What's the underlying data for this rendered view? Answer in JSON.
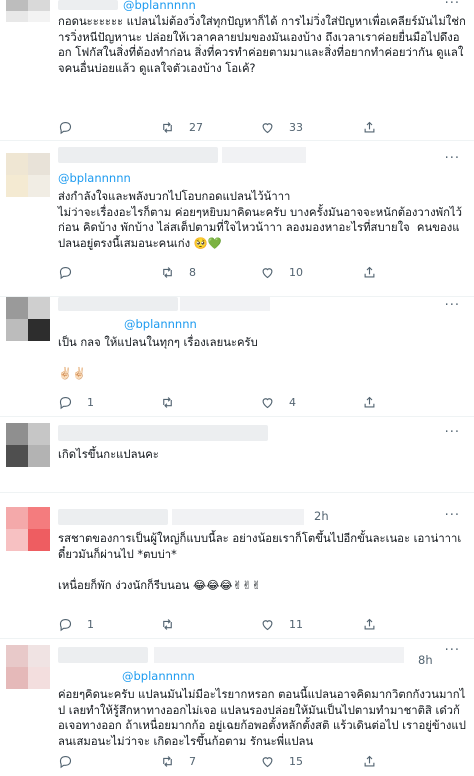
{
  "tweets": [
    {
      "name_hidden": true,
      "handle": "@bplannnnn",
      "reply_to": "",
      "time": "",
      "body": "กอดนะะะะะะ แปลนไม่ต้องวิ่งใส่ทุกปัญหาก็ได้ การไม่วิ่งใส่ปัญหาเพื่อเคลียร์มันไม่ใช่การวิ่งหนีปัญหานะ ปล่อยให้เวลาคลายปมของมันเองบ้าง ถึงเวลาเราค่อยยื่นมือไปดึงออก โฟกัสในสิ่งที่ต้องทำก่อน สิ่งที่ควรทำค่อยตามมาและสิ่งที่อยากทำค่อยว่ากัน ดูแลใจคนอื่นบ่อยแล้ว ดูแลใจตัวเองบ้าง โอเค้?",
      "replies": "",
      "retweets": "27",
      "likes": "33"
    },
    {
      "name_hidden": true,
      "handle": "",
      "reply_to": "@bplannnnn",
      "time": "",
      "body": "ส่งกำลังใจและพลังบวกไปโอบกอดแปลนไว้น้าาา\nไม่ว่าจะเรื่องอะไรก็ตาม ค่อยๆหยิบมาคิดนะครับ บางครั้งมันอาจจะหนักต้องวางพักไว้ก่อน คิดบ้าง พักบ้าง ไล่สเต็ปตามที่ใจไหวน้าาา ลองมองหาอะไรที่สบายใจ  คนของแปลนอยู่ตรงนี้เสมอนะคนเก่ง 🥺💚",
      "replies": "",
      "retweets": "8",
      "likes": "10"
    },
    {
      "name_hidden": true,
      "handle": "@bplannnnn",
      "reply_to": "",
      "time": "",
      "body": "เป็น กลจ ให้แปลนในทุกๆ เรื่องเลยนะครับ\n\n✌🏻✌🏻",
      "replies": "1",
      "retweets": "",
      "likes": "4"
    },
    {
      "name_hidden": true,
      "handle": "",
      "reply_to": "",
      "time": "",
      "body": "เกิดไรขึ้นกะแปลนคะ",
      "replies": "",
      "retweets": "",
      "likes": ""
    },
    {
      "name_hidden": true,
      "handle": "",
      "reply_to": "",
      "time": "2h",
      "body": "รสชาตของการเป็นผู้ใหญ่ก็แบบนี้ละ อย่างน้อยเราก็โตขึ้นไปอีกขั้นละเนอะ เอาน่าาาเดี๋ยวมันก็ผ่านไป *ตบบ่า*\n\nเหนื่อยก็พัก ง่วงนักก็รีบนอน 😂😂😂✌✌✌",
      "replies": "1",
      "retweets": "",
      "likes": "11"
    },
    {
      "name_hidden": true,
      "handle": "@bplannnnn",
      "reply_to": "",
      "time": "8h",
      "body": "ค่อยๆคิดนะครับ แปลนมันไม่มีอะไรยากหรอก ตอนนี้แปลนอาจคิดมากวิตกกังวนมากไป เลยทำให้รู้สึกหาทางออกไม่เจอ แปลนรองปล่อยให้มันเป็นไปตามทำมาชาติสิ เด๋วก้อเจอทางออก ถ้าเหนื่อยมากก้อ อยู่เฉยก้อพอตั้งหลักตั้งสติ แร้วเดินต่อไป เราอยู่ข้างแปลนเสมอนะไม่ว่าจะ เกิดอะไรขึ้นก้อตาม รักนะพี่แปลน",
      "replies": "",
      "retweets": "7",
      "likes": "15"
    }
  ],
  "icons": {
    "reply": "reply-icon",
    "retweet": "retweet-icon",
    "like": "heart-icon",
    "share": "share-icon",
    "more": "more-icon"
  },
  "colors": {
    "text": "#0f1419",
    "muted": "#536471",
    "link": "#1d9bf0",
    "border": "#eff3f4"
  }
}
